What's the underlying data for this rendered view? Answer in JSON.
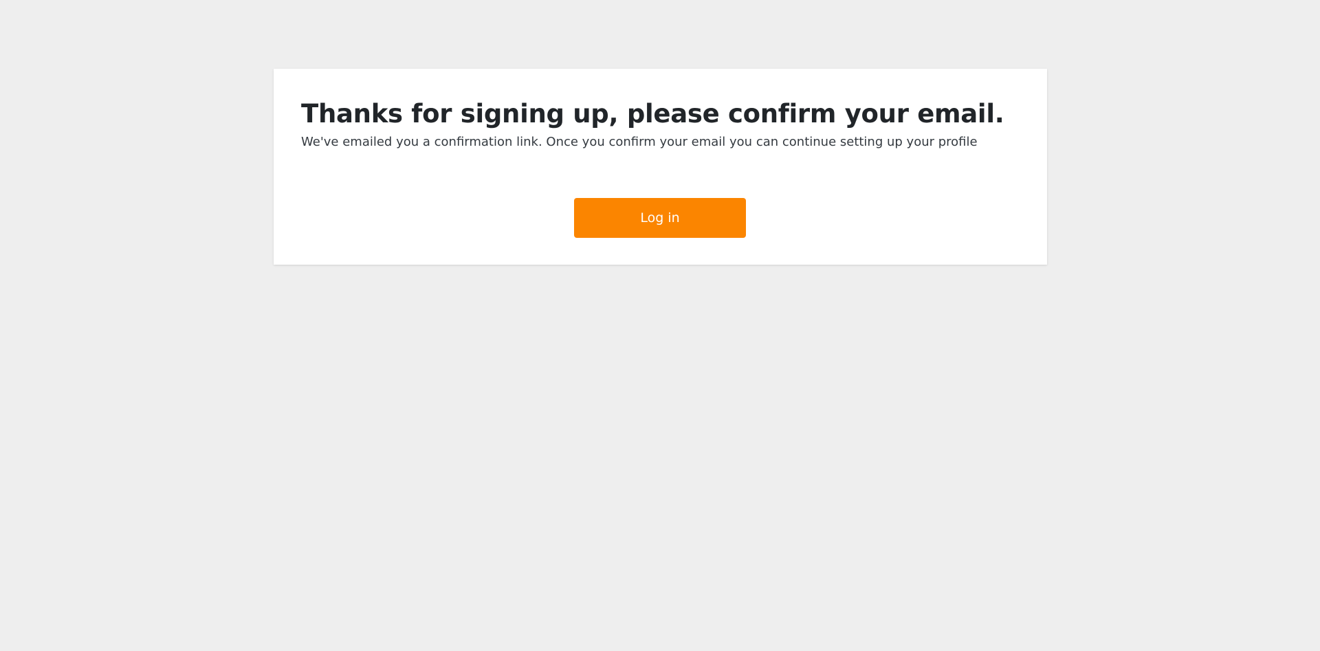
{
  "colors": {
    "page_background": "#eeeeee",
    "card_background": "#ffffff",
    "accent": "#fb8500",
    "text_primary": "#212529"
  },
  "confirmation": {
    "title": "Thanks for signing up, please confirm your email.",
    "message": "We've emailed you a confirmation link. Once you confirm your email you can continue setting up your profile",
    "login_label": "Log in"
  }
}
